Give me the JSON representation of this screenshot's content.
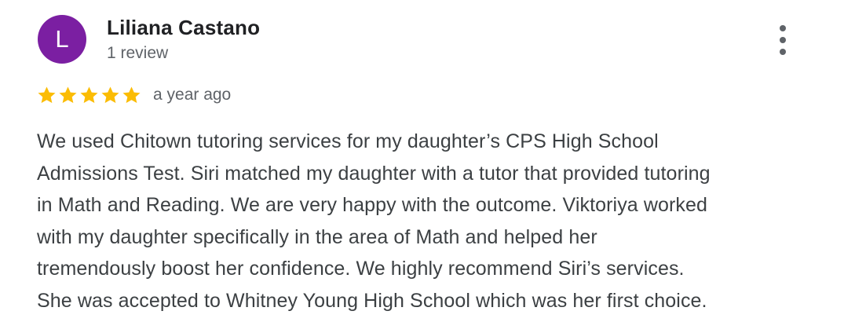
{
  "review": {
    "author": {
      "initial": "L",
      "name": "Liliana Castano",
      "review_count": "1 review",
      "avatar_color": "#7b1fa2"
    },
    "rating": 5,
    "rating_max": 5,
    "star_color": "#fbbc04",
    "timestamp": "a year ago",
    "text_lines": [
      "We used Chitown tutoring services for my daughter’s CPS High School",
      "Admissions Test. Siri matched my daughter with a tutor that provided tutoring",
      "in Math and Reading. We are very happy with the outcome. Viktoriya worked",
      "with my daughter specifically in the area of Math and helped her",
      "tremendously boost her confidence. We highly recommend Siri’s services.",
      "She was accepted to Whitney Young High School which was her first choice."
    ],
    "more_options_icon": "more-vert-icon"
  }
}
